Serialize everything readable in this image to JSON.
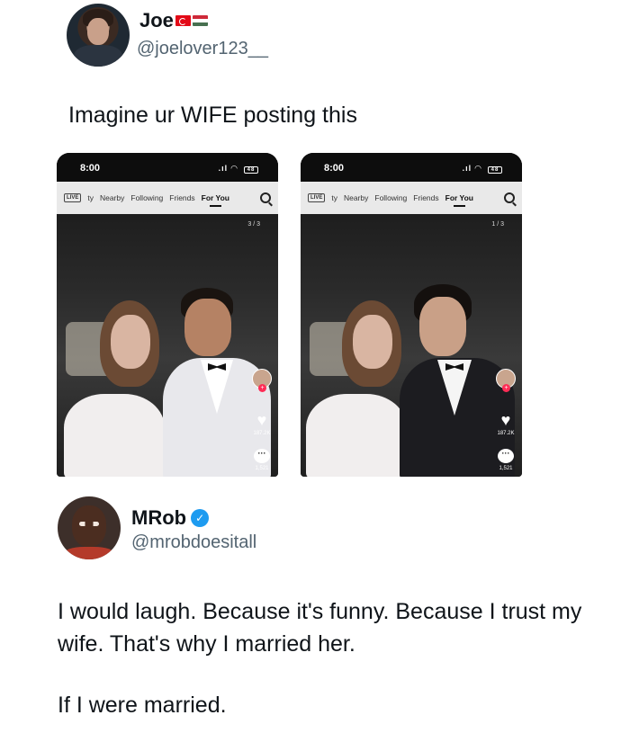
{
  "tweet1": {
    "display_name": "Joe",
    "flags": [
      "turkey-flag-icon",
      "hungary-flag-icon"
    ],
    "handle": "@joelover123__",
    "text": "Imagine ur WIFE posting this"
  },
  "screenshots": [
    {
      "time": "8:00",
      "battery": "48",
      "tabs": [
        "Nearby",
        "Following",
        "Friends",
        "For You"
      ],
      "tab_prefix": "ty",
      "active_tab": "For You",
      "counter": "3 / 3",
      "likes": "187.2K",
      "comments": "1,521",
      "groom_style": "white-suit"
    },
    {
      "time": "8:00",
      "battery": "48",
      "tabs": [
        "Nearby",
        "Following",
        "Friends",
        "For You"
      ],
      "tab_prefix": "ty",
      "active_tab": "For You",
      "counter": "1 / 3",
      "likes": "187.2K",
      "comments": "1,521",
      "groom_style": "black-suit"
    }
  ],
  "tweet2": {
    "display_name": "MRob",
    "verified": true,
    "handle": "@mrobdoesitall",
    "text": "I would laugh. Because it's funny. Because I trust my wife. That's why I married her.",
    "text2": "If I were married."
  },
  "colors": {
    "handle_gray": "#536471",
    "verified_blue": "#1d9bf0",
    "tiktok_red": "#fe2c55"
  }
}
